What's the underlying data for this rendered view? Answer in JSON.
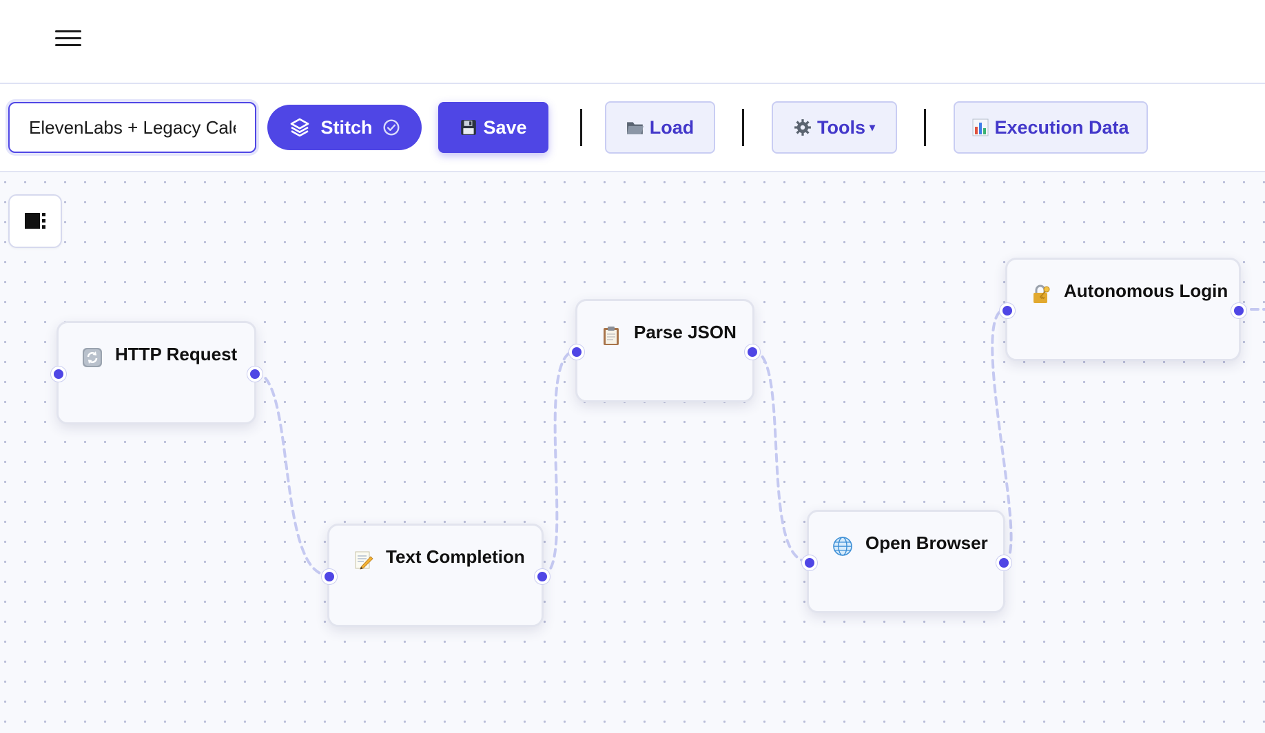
{
  "header": {
    "menu_icon": "hamburger-icon"
  },
  "toolbar": {
    "workflow_name": "ElevenLabs + Legacy Calendar",
    "stitch_label": "Stitch",
    "stitch_icon": "layers-icon",
    "stitch_status_icon": "check-circle-icon",
    "save_label": "Save",
    "save_icon": "floppy-disk-icon",
    "load_label": "Load",
    "load_icon": "folder-icon",
    "tools_label": "Tools",
    "tools_caret": "▾",
    "tools_icon": "gear-icon",
    "execution_label": "Execution Data",
    "execution_icon": "bar-chart-icon"
  },
  "canvas": {
    "panel_toggle_icon": "panel-toggle-icon",
    "nodes": [
      {
        "id": "http",
        "title": "HTTP Request",
        "icon": "refresh-icon"
      },
      {
        "id": "text",
        "title": "Text Completion",
        "icon": "memo-icon"
      },
      {
        "id": "json",
        "title": "Parse JSON",
        "icon": "clipboard-icon"
      },
      {
        "id": "browser",
        "title": "Open Browser",
        "icon": "globe-icon"
      },
      {
        "id": "login",
        "title": "Autonomous Login",
        "icon": "lock-key-icon"
      }
    ]
  },
  "colors": {
    "accent": "#4f46e5",
    "accent_light": "#eef0fc",
    "edge": "#c5c9f1",
    "canvas_bg": "#f8f9fd"
  }
}
